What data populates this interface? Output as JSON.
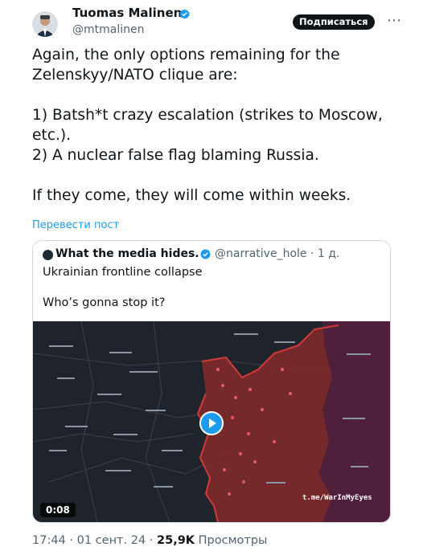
{
  "author": {
    "name": "Tuomas Malinen",
    "handle": "@mtmalinen",
    "avatar_icon": "profile-photo-avatar"
  },
  "subscribe_label": "Подписаться",
  "tweet": {
    "lines": [
      "Again, the only options remaining for the Zelenskyy/NATO clique are:",
      "1) Batsh*t crazy escalation (strikes to Moscow, etc.).",
      "2) A nuclear false flag blaming Russia.",
      "If they come, they will come within weeks."
    ],
    "translate_label": "Перевести пост"
  },
  "quote": {
    "name": "What the media hides.",
    "handle": "@narrative_hole",
    "age": "1 д.",
    "text_1": "Ukrainian frontline collapse",
    "text_2": "Who’s gonna stop it?",
    "video": {
      "duration": "0:08",
      "watermark": "t.me/WarInMyEyes"
    }
  },
  "meta": {
    "time": "17:44",
    "date": "01 сент. 24",
    "views_count": "25,9K",
    "views_label": "Просмотры"
  },
  "colors": {
    "accent": "#1d9bf0",
    "verified": "#1d9bf0",
    "map_occupied": "#8a2a2a",
    "map_russia": "#5a2440"
  }
}
